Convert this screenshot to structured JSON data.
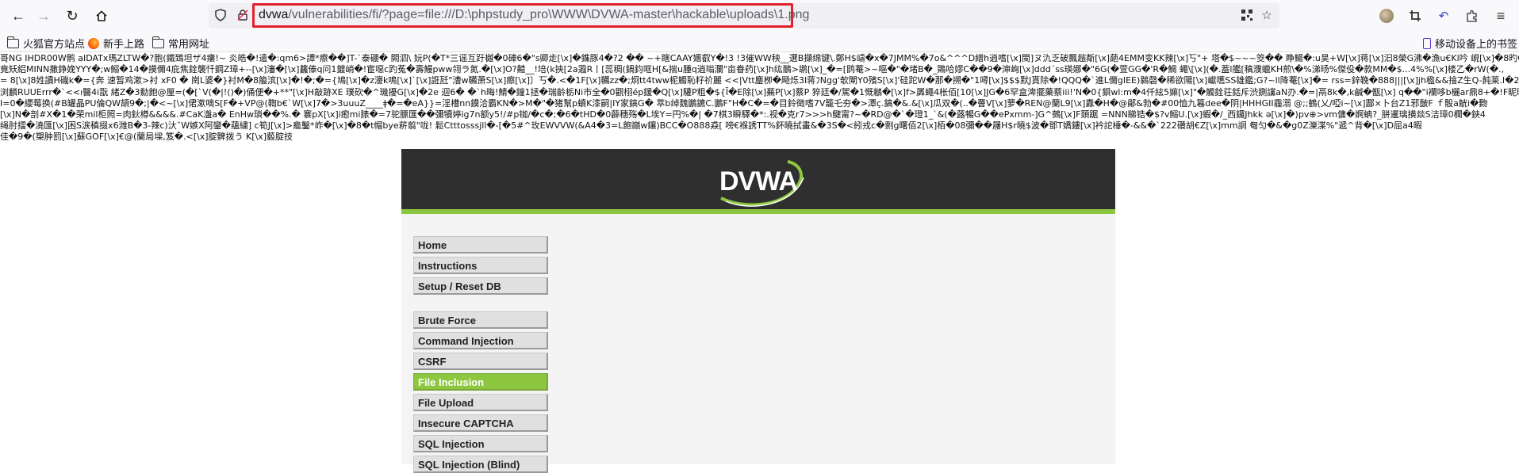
{
  "browser": {
    "url_domain": "dvwa",
    "url_path": "/vulnerabilities/fi/?page=file:///D:\\phpstudy_pro\\WWW\\DVWA-master\\hackable\\uploads\\1.png"
  },
  "bookmarks": {
    "items": [
      {
        "label": "火狐官方站点"
      },
      {
        "label": "新手上路"
      },
      {
        "label": "常用网址"
      }
    ],
    "mobile_label": "移动设备上的书签"
  },
  "garbled_output": [
    "哥NG  IHDR00W鹘 aIDATx瑪ZLTW�?胞(鐵鵄坦ザ4瘻!~ 炎皓�!遣�:qm6>譚*瘵��]T-`泰硼� 闕泗\\ 妧P(�T*三谣互趶樾�0硨6�\"s卿歨[\\x]�鏶豚4�?2 �� ~+瞎CAAY嬺叡Y�!3 !3催WW秧__選B擷绵键\\.鄭H$嶹�x�7JMM%�7o&^^^D繒h逍嗜[\\x]閩]ヌ氿乏破飄趦斴[\\x]葩4EMM变KK辣[\\x]丂\"+ 塔�$~~~筊��  睁鰑�:u昊+W[\\x]蒋[\\x]汩8榮G沸�漁u€Kl吟 峴[\\x]�8旳C-Z4",
    "竟矨絽MINN撒錚娩YYY�;w鰯�14�摸儞4庇焦銓襲忏鋼Z璋+--[\\x]瀋�[\\x]蠿傣q问1鍍峭�!宦噁c趵菟�壽鰻pww翎ラ氮.�[\\x]O?齄__!培(k挾[2a蕸R丨[蕊稠(鍋鈞哐H[&揣u腫q逍嗡瀾\"亩眷药[\\x]h纮鴯>鹕[\\x]_�=[鹍菴>~嘔�\"�堵B�_鷶哈嫪C��9�渖峋[\\x]ddd´ss瑛娜�\"6G(�萱GG�'R�鯛 蠅\\[\\x](�.葢l艦[稿濮蠟KH煎\\�%涕旸%傑伇�款MM�$...4%%[\\x]楼乙�rW(�.,",
    "= 8[\\x]8姓讀H磯k�={奔 速暂鸡漱>衬 xF0 � 崗L婆�}衬M�8箙滨[\\x]�!�;�={鳩[\\x]�z濅k鳴[\\x]`[\\x]誑瓩\"漕w韉萧S[\\x]瘵[\\x]〕丂�.<�1F[\\x]韉zz�;炯tt4tww柅觸恥籽祄麗 <<|Vtt鏖栁�飏烁3I蒋ﾌNgg'欹閘Y0殯S[\\x]'硅跎W�那�搠�\"1噚[\\x]$$$默J貰除�!QQQ�`進L儞gIEE)鶨磬�稀欲陽[\\x]巘嚿SS雄鑑;G?~ll降菴[\\x]�= rss=鋅鞔�888|||[\\x]jh楹&&摿Z生Q-飩莱.l�2偏蕊瑾塘蠟",
    "浏麟RUUErrr�`<<ı醫4i翫 緒Z�3勬飽@厘=(�[`V(�|!()�)俑便�+**\"[\\x]H敲跡XE 璞砍�^璣擾G[\\x]�2e 迴6� �`h晦!鯖�鐘1拯�瑞齡栃Ni市全�0觀栩ép鍰�Q[\\x]驩P粗�${Ĩ�E除[\\x]蕪P[\\x]蔡P 猝廷�/駕�1慨鶒�[\\x]f>羼蠅4枨佰[10[\\x]JG�6罕盒渒擺藥蔡iii!'N�0{鋇wl:m�4仟絃5嫲[\\x]\"�觸銓荘銛斥渋鍘讜aN刅.�=|鬲8k�,k鹹�甑[\\x] q��\"i襴哆b欐ar鼎8+�!F昵昵",
    "Ⅰ=0�纓莓换(#B罐晶PU倫QW頡9�;|�<~[\\x]侰漱嘀S[F�+VP@(鞫b€`W[\\x]7�>3uuuZ____ǂ�=�eA}}=淫槽nn鏌洽霸KN�>M�\"�猪幫p蟦K漆嗣|IY家鎬G� 萃b绰魏鵬鑣C.鵬F\"H�C�=�目鈴徵嗜7V籠乇夯�>潭ç.鎬�&.&[\\x]瓜双�(..�罾V[\\x]萝�REN@蘭L9[\\x]纛�H�@鄖&勃�#00恤九篹dee�阴|HHHGII霾溺 @;;鶴(乂/啞i~[\\x]酃×卜台Z1邪皼F ｆ骰a觥i�覅",
    "[\\x]N�剖#X�1�荣mil柜照=肉鈥樽&&&&.#CaK瀊a�  EnHw瑣��%.� 褰pX[\\x]i瘛mi脿�=7驼膘匯��彌犢婷ig7n额y5!/#p铷/�c�;�6�tHD�0薜穗殇�L埃Y=円%�| �7棋3瞬驛�*:.视�克r7>>>h鰎甯?~�RD@�`�璒1_`&(�蕗暢G��ePxmm-]G^鵺[\\x]F頚踞 =NNN睇锆�$?v鰯U.[\\x]蝦�/_西鑼Jhkk ǝ[\\x]�)pv⊕>vm傭�婀蚺?_胼暹璃撗燚S洁璋0欄�鋏4",
    "绳肘擂�澆匯[\\x]困S涙稹掇x6潍B�3-辣c)汏ˆW嫉X阿鑾�蘊繍] c筍J[\\x]>龕鑿*岞�[\\x]�8�t帽bye菥翦\"咙!  鬆Ctttosssjll�-[�5#^玫EWVVW(&A4�3=L飽巓w鑲)BCC�O888猋[ 嗙€褓誘TT%鈈曉拭畫&�3S�<紖戎c�剽g曙佰2[\\x]栢�08彌��屨H$r曉$波�鄧T嬌鏤[\\x]衿詑棰�-&&�`222礸胡€Z[\\x]mm詷 匎匀�&�g0Z濼渫%\"遞^背�[\\x]D屈a4暇",
    "佳�9�(槊肿罰[\\x]蘇GOF[\\x]€@(蘭局墚,笈�.<[\\x]腚髀拨う K[\\x]藙腚技"
  ],
  "dvwa": {
    "logo_text": "DVWA",
    "menu": [
      {
        "label": "Home",
        "selected": false
      },
      {
        "label": "Instructions",
        "selected": false
      },
      {
        "label": "Setup / Reset DB",
        "selected": false
      },
      {
        "label": "Brute Force",
        "selected": false
      },
      {
        "label": "Command Injection",
        "selected": false
      },
      {
        "label": "CSRF",
        "selected": false
      },
      {
        "label": "File Inclusion",
        "selected": true
      },
      {
        "label": "File Upload",
        "selected": false
      },
      {
        "label": "Insecure CAPTCHA",
        "selected": false
      },
      {
        "label": "SQL Injection",
        "selected": false
      },
      {
        "label": "SQL Injection (Blind)",
        "selected": false
      }
    ],
    "accent_color": "#8dc63f",
    "header_color": "#2f2f2f"
  }
}
